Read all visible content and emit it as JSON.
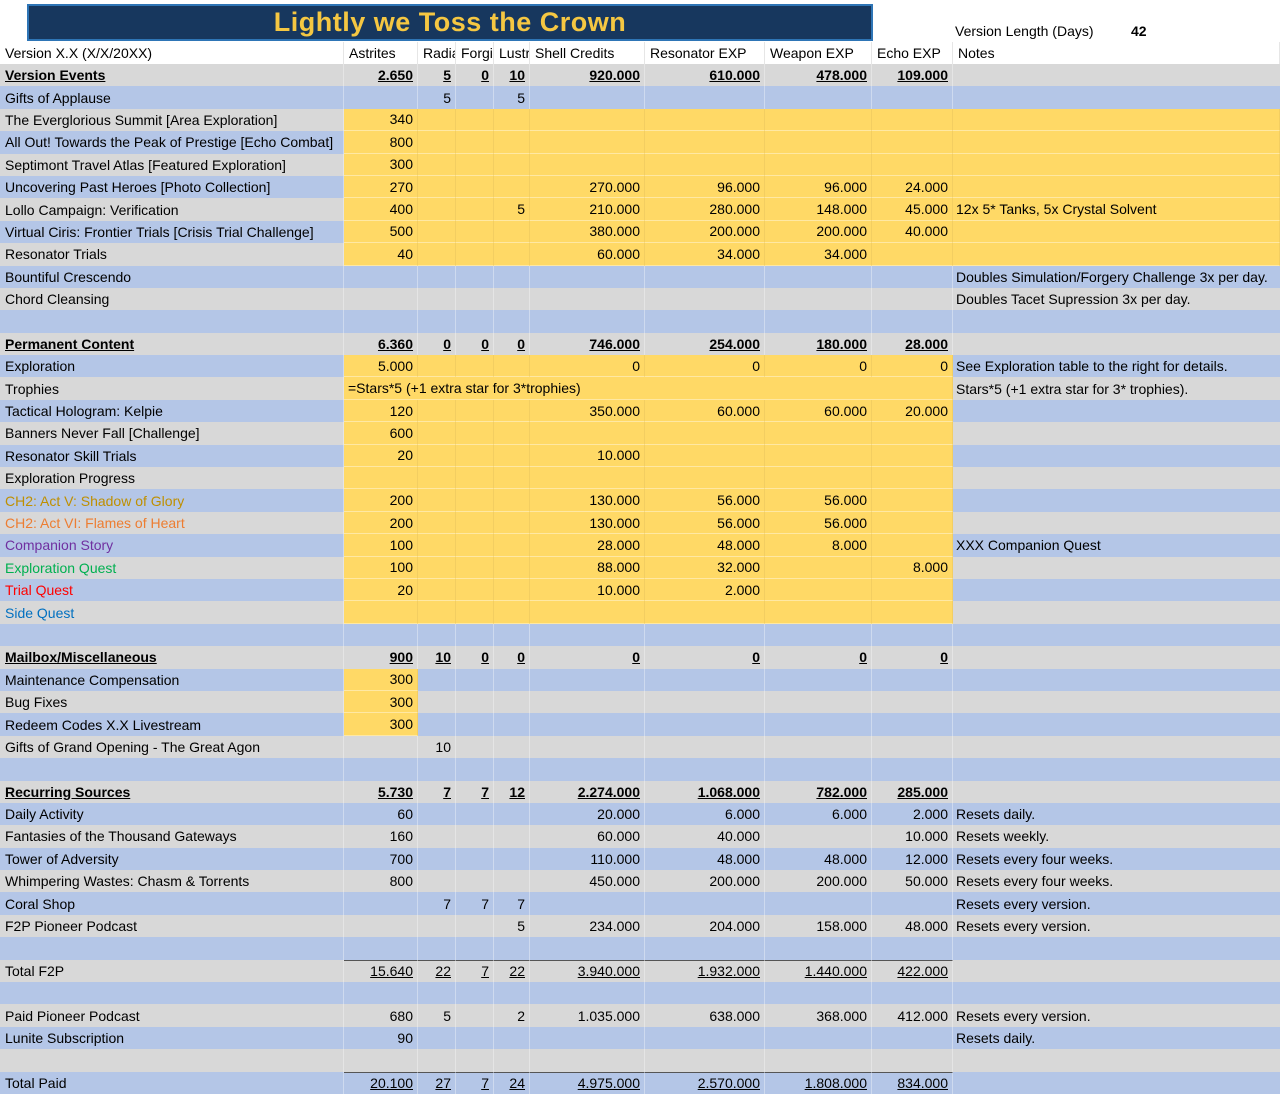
{
  "colors": {
    "banner_bg": "#17375e",
    "banner_border": "#2e75b6",
    "title_text": "#f5c742",
    "row_blue": "#b4c6e7",
    "row_gray": "#d8d8d8",
    "highlight_yellow": "#ffd966",
    "label_gold": "#bf8f00",
    "label_orange": "#ed7d31",
    "label_purple": "#7030a0",
    "label_green": "#00b050",
    "label_red": "#ff0000",
    "label_blue": "#0070c0"
  },
  "banner": {
    "title": "Lightly we Toss the Crown"
  },
  "meta": {
    "label": "Version Length (Days)",
    "value": "42"
  },
  "columns": [
    "Version X.X (X/X/20XX)",
    "Astrites",
    "Radia",
    "Forgi",
    "Lustr",
    "Shell Credits",
    "Resonator EXP",
    "Weapon EXP",
    "Echo EXP",
    "Notes"
  ],
  "rows": [
    {
      "label": "Version Events",
      "type": "section",
      "values": [
        "2.650",
        "5",
        "0",
        "10",
        "920.000",
        "610.000",
        "478.000",
        "109.000"
      ],
      "notes": ""
    },
    {
      "label": "Gifts of Applause",
      "values": [
        "",
        "5",
        "",
        "5",
        "",
        "",
        "",
        ""
      ],
      "notes": ""
    },
    {
      "label": "The Everglorious Summit [Area Exploration]",
      "values": [
        "340",
        "",
        "",
        "",
        "",
        "",
        "",
        ""
      ],
      "hl": "full",
      "notes": ""
    },
    {
      "label": "All Out! Towards the Peak of Prestige [Echo Combat]",
      "values": [
        "800",
        "",
        "",
        "",
        "",
        "",
        "",
        ""
      ],
      "hl": "full",
      "notes": ""
    },
    {
      "label": "Septimont Travel Atlas [Featured Exploration]",
      "values": [
        "300",
        "",
        "",
        "",
        "",
        "",
        "",
        ""
      ],
      "hl": "full",
      "notes": ""
    },
    {
      "label": "Uncovering Past Heroes [Photo Collection]",
      "values": [
        "270",
        "",
        "",
        "",
        "270.000",
        "96.000",
        "96.000",
        "24.000"
      ],
      "hl": "full",
      "notes": ""
    },
    {
      "label": "Lollo Campaign: Verification",
      "values": [
        "400",
        "",
        "",
        "5",
        "210.000",
        "280.000",
        "148.000",
        "45.000"
      ],
      "hl": "full",
      "notes": "12x 5* Tanks, 5x Crystal Solvent"
    },
    {
      "label": "Virtual Ciris: Frontier Trials [Crisis Trial Challenge]",
      "values": [
        "500",
        "",
        "",
        "",
        "380.000",
        "200.000",
        "200.000",
        "40.000"
      ],
      "hl": "full",
      "notes": ""
    },
    {
      "label": "Resonator Trials",
      "values": [
        "40",
        "",
        "",
        "",
        "60.000",
        "34.000",
        "34.000",
        ""
      ],
      "hl": "full",
      "notes": ""
    },
    {
      "label": "Bountiful Crescendo",
      "values": [
        "",
        "",
        "",
        "",
        "",
        "",
        "",
        ""
      ],
      "notes": "Doubles Simulation/Forgery Challenge 3x per day."
    },
    {
      "label": "Chord Cleansing",
      "values": [
        "",
        "",
        "",
        "",
        "",
        "",
        "",
        ""
      ],
      "notes": "Doubles Tacet Supression 3x per day."
    },
    {
      "type": "empty"
    },
    {
      "label": "Permanent Content",
      "type": "section",
      "values": [
        "6.360",
        "0",
        "0",
        "0",
        "746.000",
        "254.000",
        "180.000",
        "28.000"
      ],
      "notes": ""
    },
    {
      "label": "Exploration",
      "values": [
        "5.000",
        "",
        "",
        "",
        "0",
        "0",
        "0",
        "0"
      ],
      "hl": "vals",
      "notes": "See Exploration table to the right for details."
    },
    {
      "label": "Trophies",
      "spill": true,
      "values": [
        "=Stars*5 (+1 extra star for 3*trophies)"
      ],
      "hl": "vals",
      "notes": "Stars*5 (+1 extra star for 3* trophies)."
    },
    {
      "label": "Tactical Hologram: Kelpie",
      "values": [
        "120",
        "",
        "",
        "",
        "350.000",
        "60.000",
        "60.000",
        "20.000"
      ],
      "hl": "vals",
      "notes": ""
    },
    {
      "label": "Banners Never Fall [Challenge]",
      "values": [
        "600",
        "",
        "",
        "",
        "",
        "",
        "",
        ""
      ],
      "hl": "vals",
      "notes": ""
    },
    {
      "label": "Resonator Skill Trials",
      "values": [
        "20",
        "",
        "",
        "",
        "10.000",
        "",
        "",
        ""
      ],
      "hl": "vals",
      "notes": ""
    },
    {
      "label": "Exploration Progress",
      "values": [
        "",
        "",
        "",
        "",
        "",
        "",
        "",
        ""
      ],
      "hl": "vals",
      "notes": ""
    },
    {
      "label": "CH2: Act V: Shadow of Glory",
      "color": "gold",
      "values": [
        "200",
        "",
        "",
        "",
        "130.000",
        "56.000",
        "56.000",
        ""
      ],
      "hl": "vals",
      "notes": ""
    },
    {
      "label": "CH2: Act VI: Flames of Heart",
      "color": "orange",
      "values": [
        "200",
        "",
        "",
        "",
        "130.000",
        "56.000",
        "56.000",
        ""
      ],
      "hl": "vals",
      "notes": ""
    },
    {
      "label": "Companion Story",
      "color": "purple",
      "values": [
        "100",
        "",
        "",
        "",
        "28.000",
        "48.000",
        "8.000",
        ""
      ],
      "hl": "vals",
      "notes": "XXX Companion Quest"
    },
    {
      "label": "Exploration Quest",
      "color": "green",
      "values": [
        "100",
        "",
        "",
        "",
        "88.000",
        "32.000",
        "",
        "8.000"
      ],
      "hl": "vals",
      "notes": ""
    },
    {
      "label": "Trial Quest",
      "color": "red",
      "values": [
        "20",
        "",
        "",
        "",
        "10.000",
        "2.000",
        "",
        ""
      ],
      "hl": "vals",
      "notes": ""
    },
    {
      "label": "Side Quest",
      "color": "blue",
      "values": [
        "",
        "",
        "",
        "",
        "",
        "",
        "",
        ""
      ],
      "hl": "vals",
      "notes": ""
    },
    {
      "type": "empty"
    },
    {
      "label": "Mailbox/Miscellaneous",
      "type": "section",
      "values": [
        "900",
        "10",
        "0",
        "0",
        "0",
        "0",
        "0",
        "0"
      ],
      "notes": ""
    },
    {
      "label": "Maintenance Compensation",
      "values": [
        "300",
        "",
        "",
        "",
        "",
        "",
        "",
        ""
      ],
      "hl": "ast",
      "notes": ""
    },
    {
      "label": "Bug Fixes",
      "values": [
        "300",
        "",
        "",
        "",
        "",
        "",
        "",
        ""
      ],
      "hl": "ast",
      "notes": ""
    },
    {
      "label": "Redeem Codes X.X Livestream",
      "values": [
        "300",
        "",
        "",
        "",
        "",
        "",
        "",
        ""
      ],
      "hl": "ast",
      "notes": ""
    },
    {
      "label": "Gifts of Grand Opening - The Great Agon",
      "values": [
        "",
        "10",
        "",
        "",
        "",
        "",
        "",
        ""
      ],
      "notes": ""
    },
    {
      "type": "empty"
    },
    {
      "label": "Recurring Sources",
      "type": "section",
      "values": [
        "5.730",
        "7",
        "7",
        "12",
        "2.274.000",
        "1.068.000",
        "782.000",
        "285.000"
      ],
      "notes": ""
    },
    {
      "label": "Daily Activity",
      "values": [
        "60",
        "",
        "",
        "",
        "20.000",
        "6.000",
        "6.000",
        "2.000"
      ],
      "notes": "Resets daily."
    },
    {
      "label": "Fantasies of the Thousand Gateways",
      "values": [
        "160",
        "",
        "",
        "",
        "60.000",
        "40.000",
        "",
        "10.000"
      ],
      "notes": "Resets weekly."
    },
    {
      "label": "Tower of Adversity",
      "values": [
        "700",
        "",
        "",
        "",
        "110.000",
        "48.000",
        "48.000",
        "12.000"
      ],
      "notes": "Resets every four weeks."
    },
    {
      "label": "Whimpering Wastes: Chasm & Torrents",
      "values": [
        "800",
        "",
        "",
        "",
        "450.000",
        "200.000",
        "200.000",
        "50.000"
      ],
      "notes": "Resets every four weeks."
    },
    {
      "label": "Coral Shop",
      "values": [
        "",
        "7",
        "7",
        "7",
        "",
        "",
        "",
        ""
      ],
      "notes": "Resets every version."
    },
    {
      "label": "F2P Pioneer Podcast",
      "values": [
        "",
        "",
        "",
        "5",
        "234.000",
        "204.000",
        "158.000",
        "48.000"
      ],
      "notes": "Resets every version."
    },
    {
      "type": "empty"
    },
    {
      "label": "Total F2P",
      "type": "total",
      "values": [
        "15.640",
        "22",
        "7",
        "22",
        "3.940.000",
        "1.932.000",
        "1.440.000",
        "422.000"
      ],
      "notes": ""
    },
    {
      "type": "empty"
    },
    {
      "label": "Paid Pioneer Podcast",
      "values": [
        "680",
        "5",
        "",
        "2",
        "1.035.000",
        "638.000",
        "368.000",
        "412.000"
      ],
      "notes": "Resets every version."
    },
    {
      "label": "Lunite Subscription",
      "values": [
        "90",
        "",
        "",
        "",
        "",
        "",
        "",
        ""
      ],
      "notes": "Resets daily."
    },
    {
      "type": "empty"
    },
    {
      "label": "Total Paid",
      "type": "total",
      "values": [
        "20.100",
        "27",
        "7",
        "24",
        "4.975.000",
        "2.570.000",
        "1.808.000",
        "834.000"
      ],
      "notes": ""
    }
  ]
}
